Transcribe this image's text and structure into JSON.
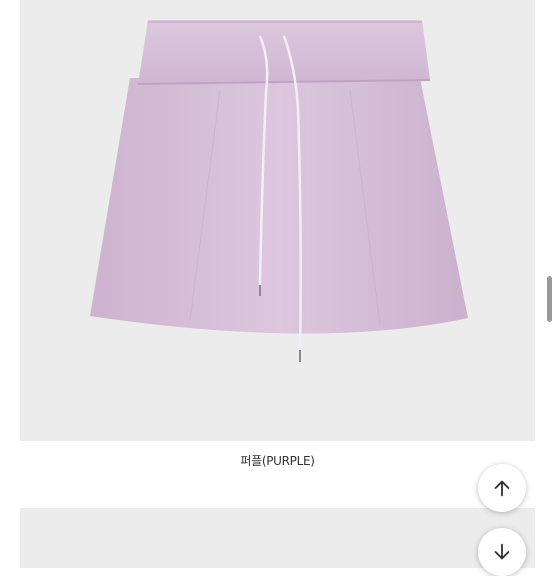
{
  "product": {
    "image_subject": "skirt-icon",
    "skirt_color": "#d9c3db",
    "caption": "퍼플(PURPLE)"
  },
  "controls": {
    "scroll_top_icon": "arrow-up-icon",
    "scroll_down_icon": "arrow-down-icon"
  }
}
